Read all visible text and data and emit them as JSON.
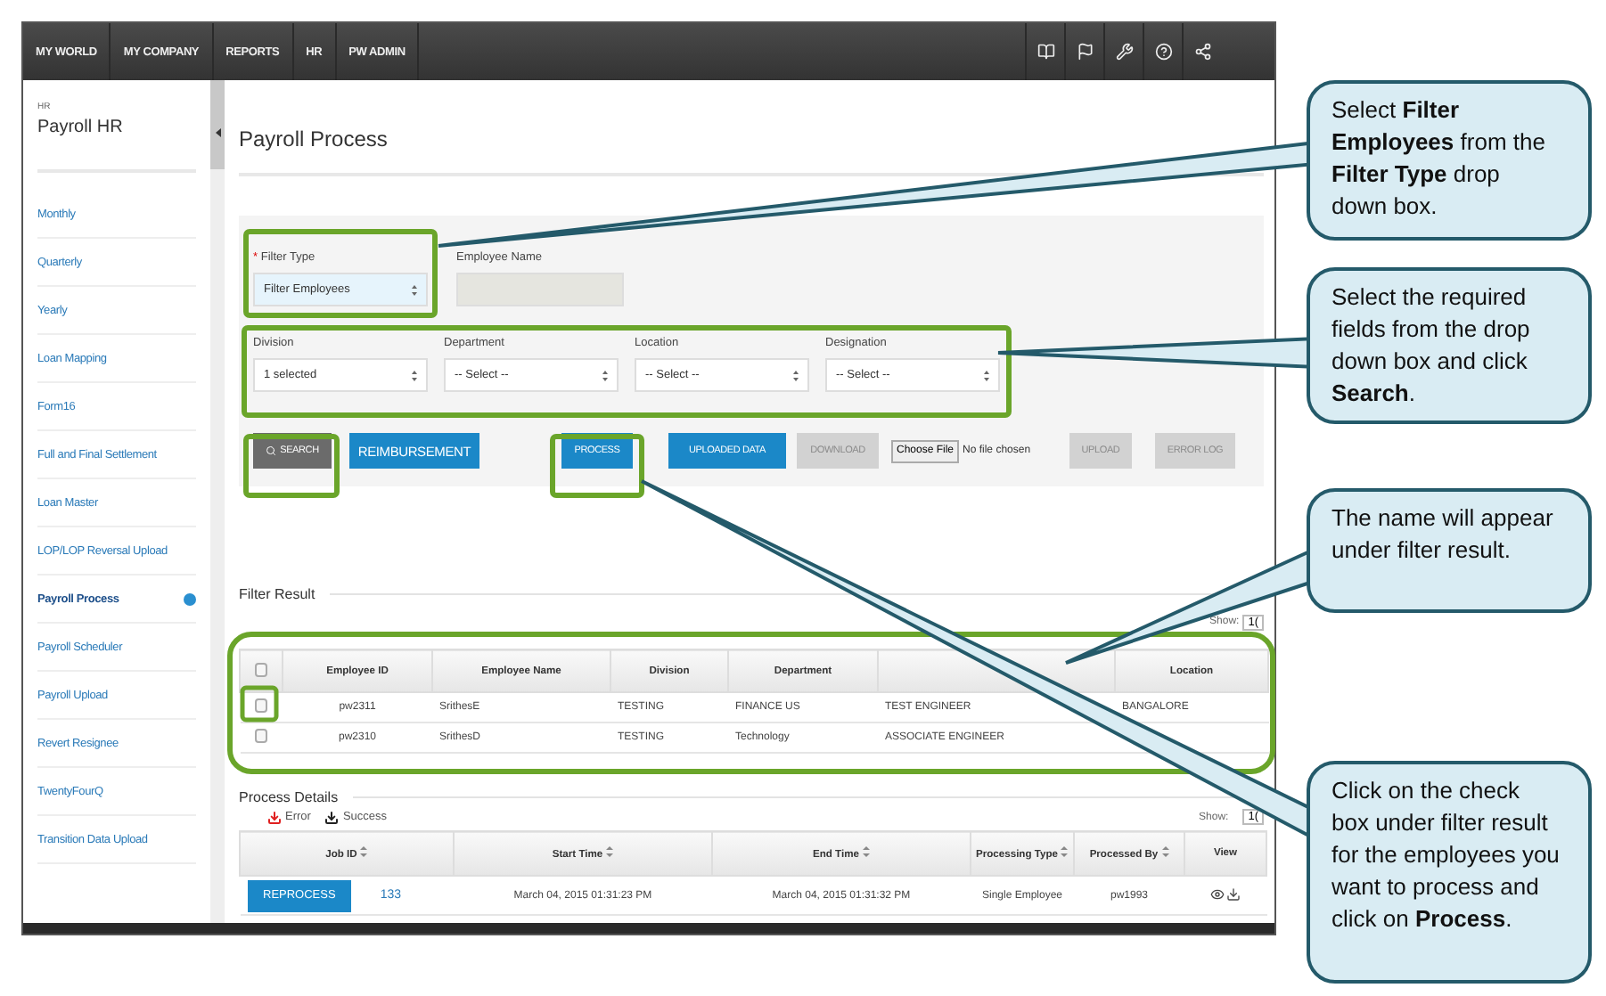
{
  "top_nav": {
    "items": [
      {
        "label": "MY WORLD"
      },
      {
        "label": "MY COMPANY"
      },
      {
        "label": "REPORTS"
      },
      {
        "label": "HR"
      },
      {
        "label": "PW ADMIN"
      }
    ]
  },
  "sidebar": {
    "module": "HR",
    "title": "Payroll HR",
    "items": [
      {
        "label": "Monthly",
        "selected": false
      },
      {
        "label": "Quarterly",
        "selected": false
      },
      {
        "label": "Yearly",
        "selected": false
      },
      {
        "label": "Loan Mapping",
        "selected": false
      },
      {
        "label": "Form16",
        "selected": false
      },
      {
        "label": "Full and Final Settlement",
        "selected": false
      },
      {
        "label": "Loan Master",
        "selected": false
      },
      {
        "label": "LOP/LOP Reversal Upload",
        "selected": false
      },
      {
        "label": "Payroll Process",
        "selected": true
      },
      {
        "label": "Payroll Scheduler",
        "selected": false
      },
      {
        "label": "Payroll Upload",
        "selected": false
      },
      {
        "label": "Revert Resignee",
        "selected": false
      },
      {
        "label": "TwentyFourQ",
        "selected": false
      },
      {
        "label": "Transition Data Upload",
        "selected": false
      }
    ]
  },
  "page_title": "Payroll Process",
  "filter_form": {
    "filter_type": {
      "required_mark": "*",
      "label": "Filter Type",
      "value": "Filter Employees"
    },
    "employee_name": {
      "label": "Employee Name",
      "disabled": true
    },
    "selects": [
      {
        "label": "Division",
        "value": "1 selected"
      },
      {
        "label": "Department",
        "value": "-- Select --"
      },
      {
        "label": "Location",
        "value": "-- Select --"
      },
      {
        "label": "Designation",
        "value": "-- Select --"
      }
    ],
    "buttons": [
      {
        "kind": "search",
        "label": "SEARCH",
        "disabled": false
      },
      {
        "kind": "primary",
        "label": "REIMBURSEMENT",
        "disabled": false
      },
      {
        "kind": "primary",
        "label": "PROCESS",
        "disabled": false
      },
      {
        "kind": "primary",
        "label": "UPLOADED DATA",
        "disabled": false
      },
      {
        "kind": "primary",
        "label": "DOWNLOAD",
        "disabled": true
      },
      {
        "kind": "file",
        "label": "Choose File",
        "status": "No file chosen",
        "disabled": false
      },
      {
        "kind": "primary",
        "label": "UPLOAD",
        "disabled": true
      },
      {
        "kind": "primary",
        "label": "ERROR LOG",
        "disabled": true
      }
    ]
  },
  "filter_result": {
    "title": "Filter Result",
    "show_label": "Show:",
    "show_value": "1(",
    "select_all_checked": false,
    "columns": [
      "Employee ID",
      "Employee Name",
      "Division",
      "Department",
      "",
      "Location"
    ],
    "rows": [
      {
        "checked": false,
        "cells": [
          "pw2311",
          "SrithesE",
          "TESTING",
          "FINANCE US",
          "TEST ENGINEER",
          "BANGALORE"
        ]
      },
      {
        "checked": false,
        "cells": [
          "pw2310",
          "SrithesD",
          "TESTING",
          "Technology",
          "ASSOCIATE ENGINEER",
          ""
        ]
      }
    ]
  },
  "process_details": {
    "title": "Process Details",
    "legend": [
      {
        "kind": "error",
        "label": "Error"
      },
      {
        "kind": "success",
        "label": "Success"
      }
    ],
    "show_label": "Show:",
    "show_value": "1(",
    "columns": [
      {
        "label": "Job ID",
        "sortable": true
      },
      {
        "label": "Start Time",
        "sortable": true
      },
      {
        "label": "End Time",
        "sortable": true
      },
      {
        "label": "Processing Type",
        "sortable": true
      },
      {
        "label": "Processed By",
        "sortable": true
      },
      {
        "label": "View",
        "sortable": false
      }
    ],
    "rows": [
      {
        "action": "REPROCESS",
        "job_id": "133",
        "start_time": "March 04, 2015 01:31:23 PM",
        "end_time": "March 04, 2015 01:31:32 PM",
        "processing_type": "Single Employee",
        "processed_by": "pw1993"
      }
    ]
  },
  "callouts": [
    {
      "text": "Select **Filter Employees** from the **Filter Type** drop down box."
    },
    {
      "text": "Select the required fields from the drop down box and click **Search**."
    },
    {
      "text": "The name will appear under filter result."
    },
    {
      "text": "Click on the check box under filter result for the employees you want to process and click on **Process**."
    }
  ]
}
